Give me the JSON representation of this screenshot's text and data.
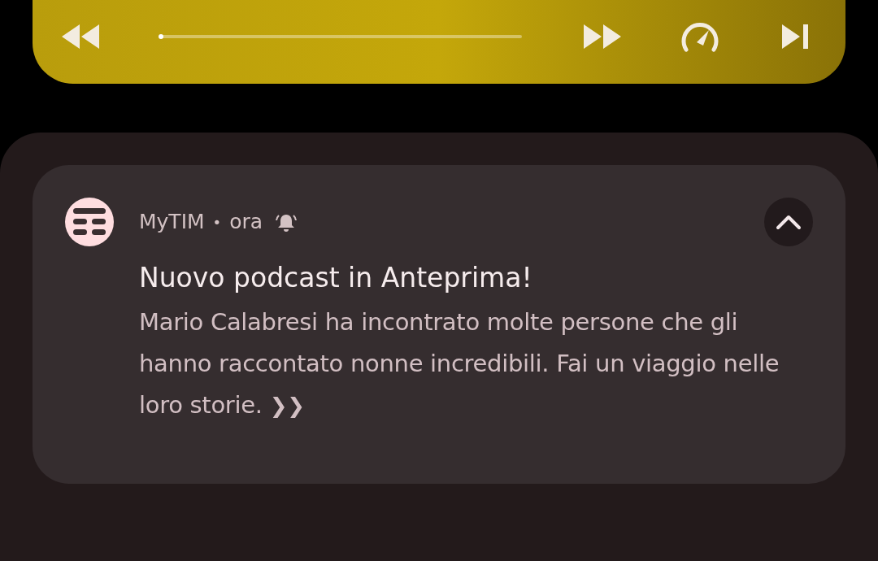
{
  "media_player": {
    "progress": {
      "level": 0.0
    }
  },
  "notification": {
    "app_name": "MyTIM",
    "separator": "•",
    "time": "ora",
    "expanded": true,
    "title": "Nuovo podcast in Anteprima!",
    "body": "Mario Calabresi ha incontrato molte persone che gli hanno raccontato nonne incredibili. Fai un viaggio nelle loro storie.",
    "more": "❯❯"
  }
}
